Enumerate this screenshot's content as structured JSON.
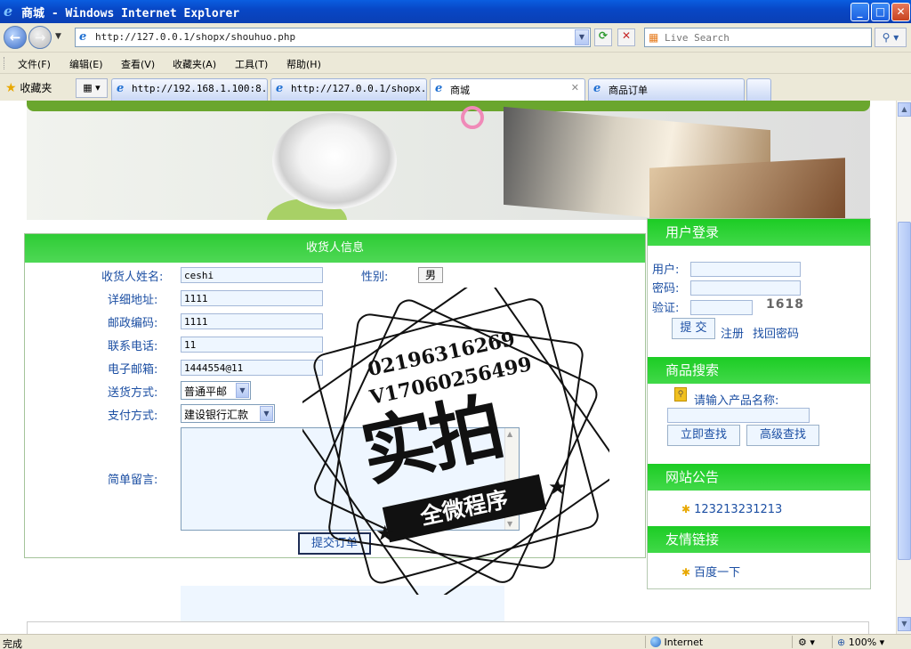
{
  "window": {
    "title": "商城 - Windows Internet Explorer",
    "minimize": "_",
    "maximize": "□",
    "close": "✕"
  },
  "address_bar": {
    "url": "http://127.0.0.1/shopx/shouhuo.php",
    "search_placeholder": "Live Search"
  },
  "menu": {
    "items": [
      "文件(F)",
      "编辑(E)",
      "查看(V)",
      "收藏夹(A)",
      "工具(T)",
      "帮助(H)"
    ]
  },
  "tabs": {
    "favorites_label": "收藏夹",
    "items": [
      {
        "label": "http://192.168.1.100:8..."
      },
      {
        "label": "http://127.0.0.1/shopx..."
      },
      {
        "label": "商城"
      },
      {
        "label": "商品订单"
      }
    ]
  },
  "form": {
    "header": "收货人信息",
    "fields": {
      "name": {
        "label": "收货人姓名:",
        "value": "ceshi"
      },
      "gender": {
        "label": "性别:",
        "value": "男"
      },
      "address": {
        "label": "详细地址:",
        "value": "1111"
      },
      "postcode": {
        "label": "邮政编码:",
        "value": "1111"
      },
      "phone": {
        "label": "联系电话:",
        "value": "11"
      },
      "email": {
        "label": "电子邮箱:",
        "value": "1444554@11"
      },
      "delivery": {
        "label": "送货方式:",
        "value": "普通平邮"
      },
      "payment": {
        "label": "支付方式:",
        "value": "建设银行汇款"
      },
      "message": {
        "label": "简单留言:",
        "value": ""
      }
    },
    "submit_label": "提交订单"
  },
  "sidebar": {
    "login": {
      "title": "用户登录",
      "user_label": "用户:",
      "password_label": "密码:",
      "verify_label": "验证:",
      "captcha": "1618",
      "submit": "提 交",
      "register": "注册",
      "recover": "找回密码"
    },
    "search": {
      "title": "商品搜索",
      "prompt": "请输入产品名称:",
      "search_now": "立即查找",
      "advanced": "高级查找"
    },
    "notice": {
      "title": "网站公告",
      "items": [
        "123213231213"
      ]
    },
    "links": {
      "title": "友情链接",
      "items": [
        "百度一下"
      ]
    }
  },
  "watermark": {
    "line1": "02196316269",
    "line2": "V17060256499",
    "big": "实拍",
    "ribbon": "全微程序"
  },
  "status": {
    "left": "完成",
    "zone": "Internet",
    "zoom": "100%"
  },
  "colors": {
    "accent_green": "#2ecc35",
    "link_blue": "#1c4fa3",
    "titlebar_blue": "#0a5ee0"
  }
}
